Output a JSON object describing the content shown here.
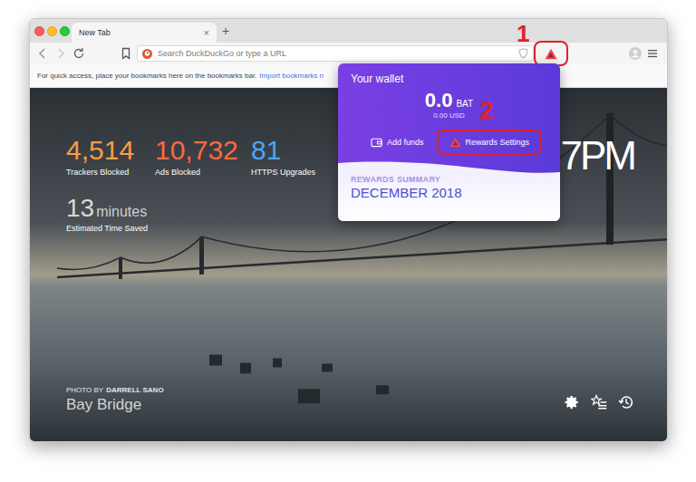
{
  "tabs": [
    {
      "label": "New Tab",
      "selected": true,
      "close": "×"
    }
  ],
  "new_tab": "+",
  "address_bar": {
    "placeholder": "Search DuckDuckGo or type a URL"
  },
  "rewards_button": {
    "highlighted": true
  },
  "bookmarks_bar": {
    "hint": "For quick access, place your bookmarks here on the bookmarks bar.",
    "link": "Import bookmarks n"
  },
  "stats": [
    {
      "value": "4,514",
      "label": "Trackers Blocked",
      "color": "#f99d45"
    },
    {
      "value": "10,732",
      "label": "Ads Blocked",
      "color": "#fa6a3f"
    },
    {
      "value": "81",
      "label": "HTTPS Upgrades",
      "color": "#4ba6f4"
    }
  ],
  "time_saved": {
    "value": "13",
    "unit": "minutes",
    "label": "Estimated Time Saved"
  },
  "clock": "7PM",
  "photo_credit": {
    "prefix": "PHOTO BY",
    "author": "DARRELL SANO",
    "title": "Bay Bridge"
  },
  "wallet": {
    "title": "Your wallet",
    "balance": "0.0",
    "currency": "BAT",
    "usd": "0.00 USD",
    "actions": [
      {
        "label": "Add funds",
        "kind": "funds",
        "highlighted": false
      },
      {
        "label": "Rewards Settings",
        "kind": "settings",
        "highlighted": true
      }
    ],
    "summary_title": "REWARDS SUMMARY",
    "summary_period": "DECEMBER 2018"
  },
  "annotations": [
    {
      "number": "1"
    },
    {
      "number": "2"
    }
  ]
}
